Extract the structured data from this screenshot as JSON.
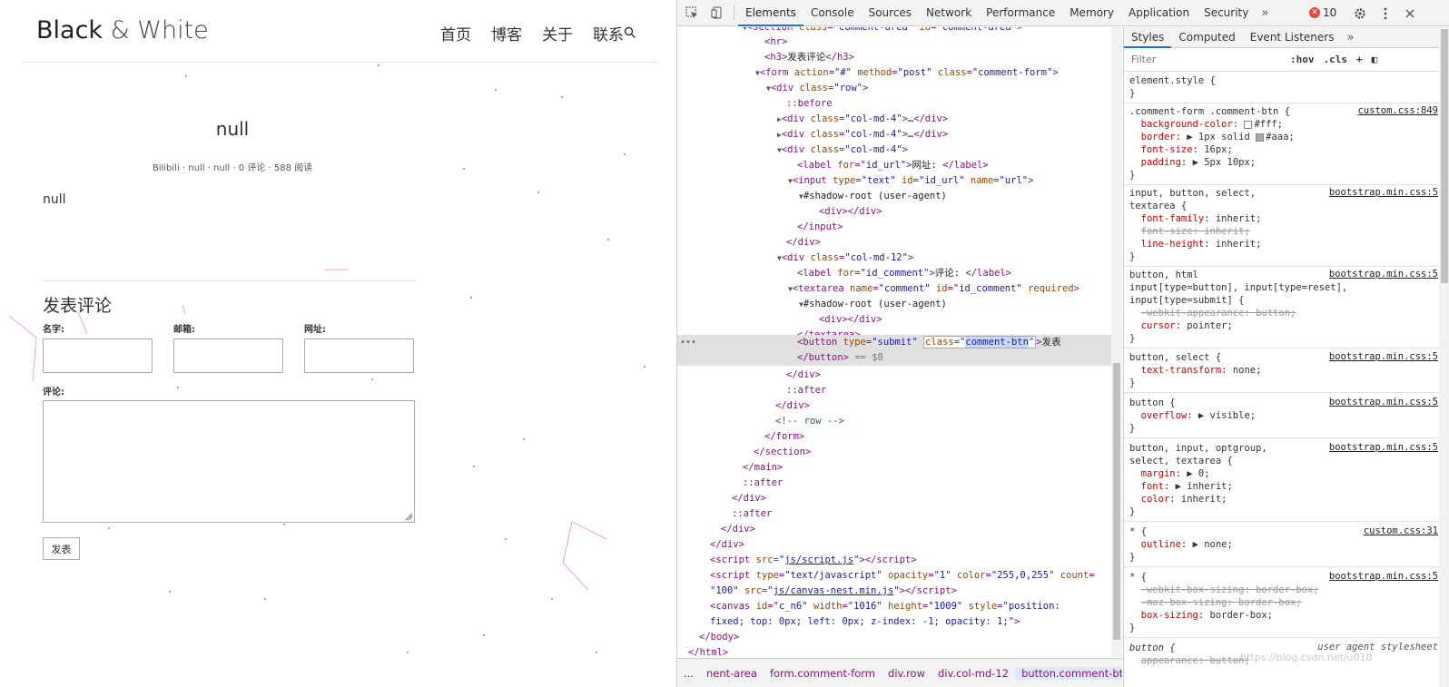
{
  "preview": {
    "brand": {
      "name": "Black",
      "amp": " & White"
    },
    "nav": [
      "首页",
      "博客",
      "关于",
      "联系"
    ],
    "post_title": "null",
    "post_meta": "Bilibili · null · null · 0 评论 · 588 阅读",
    "post_body": "null",
    "comment_heading": "发表评论",
    "labels": {
      "name": "名字:",
      "email": "邮箱:",
      "url": "网址:",
      "comment": "评论:"
    },
    "submit_label": "发表"
  },
  "devtools": {
    "tabs": [
      "Elements",
      "Console",
      "Sources",
      "Network",
      "Performance",
      "Memory",
      "Application",
      "Security"
    ],
    "active_tab": "Elements",
    "error_count": "10",
    "style_tabs": [
      "Styles",
      "Computed",
      "Event Listeners"
    ],
    "filter_placeholder": "Filter",
    "filter_buttons": [
      ":hov",
      ".cls",
      "+"
    ],
    "breadcrumbs": [
      "...",
      "nent-area",
      "form.comment-form",
      "div.row",
      "div.col-md-12",
      "button.comment-btn",
      "..."
    ],
    "watermark": "https://blog.csdn.net/u010"
  },
  "icons": {
    "search": "search-icon",
    "inspect": "inspect-icon",
    "device": "device-toolbar-icon",
    "settings": "gear-icon",
    "menu": "kebab-icon",
    "error": "error-icon"
  }
}
